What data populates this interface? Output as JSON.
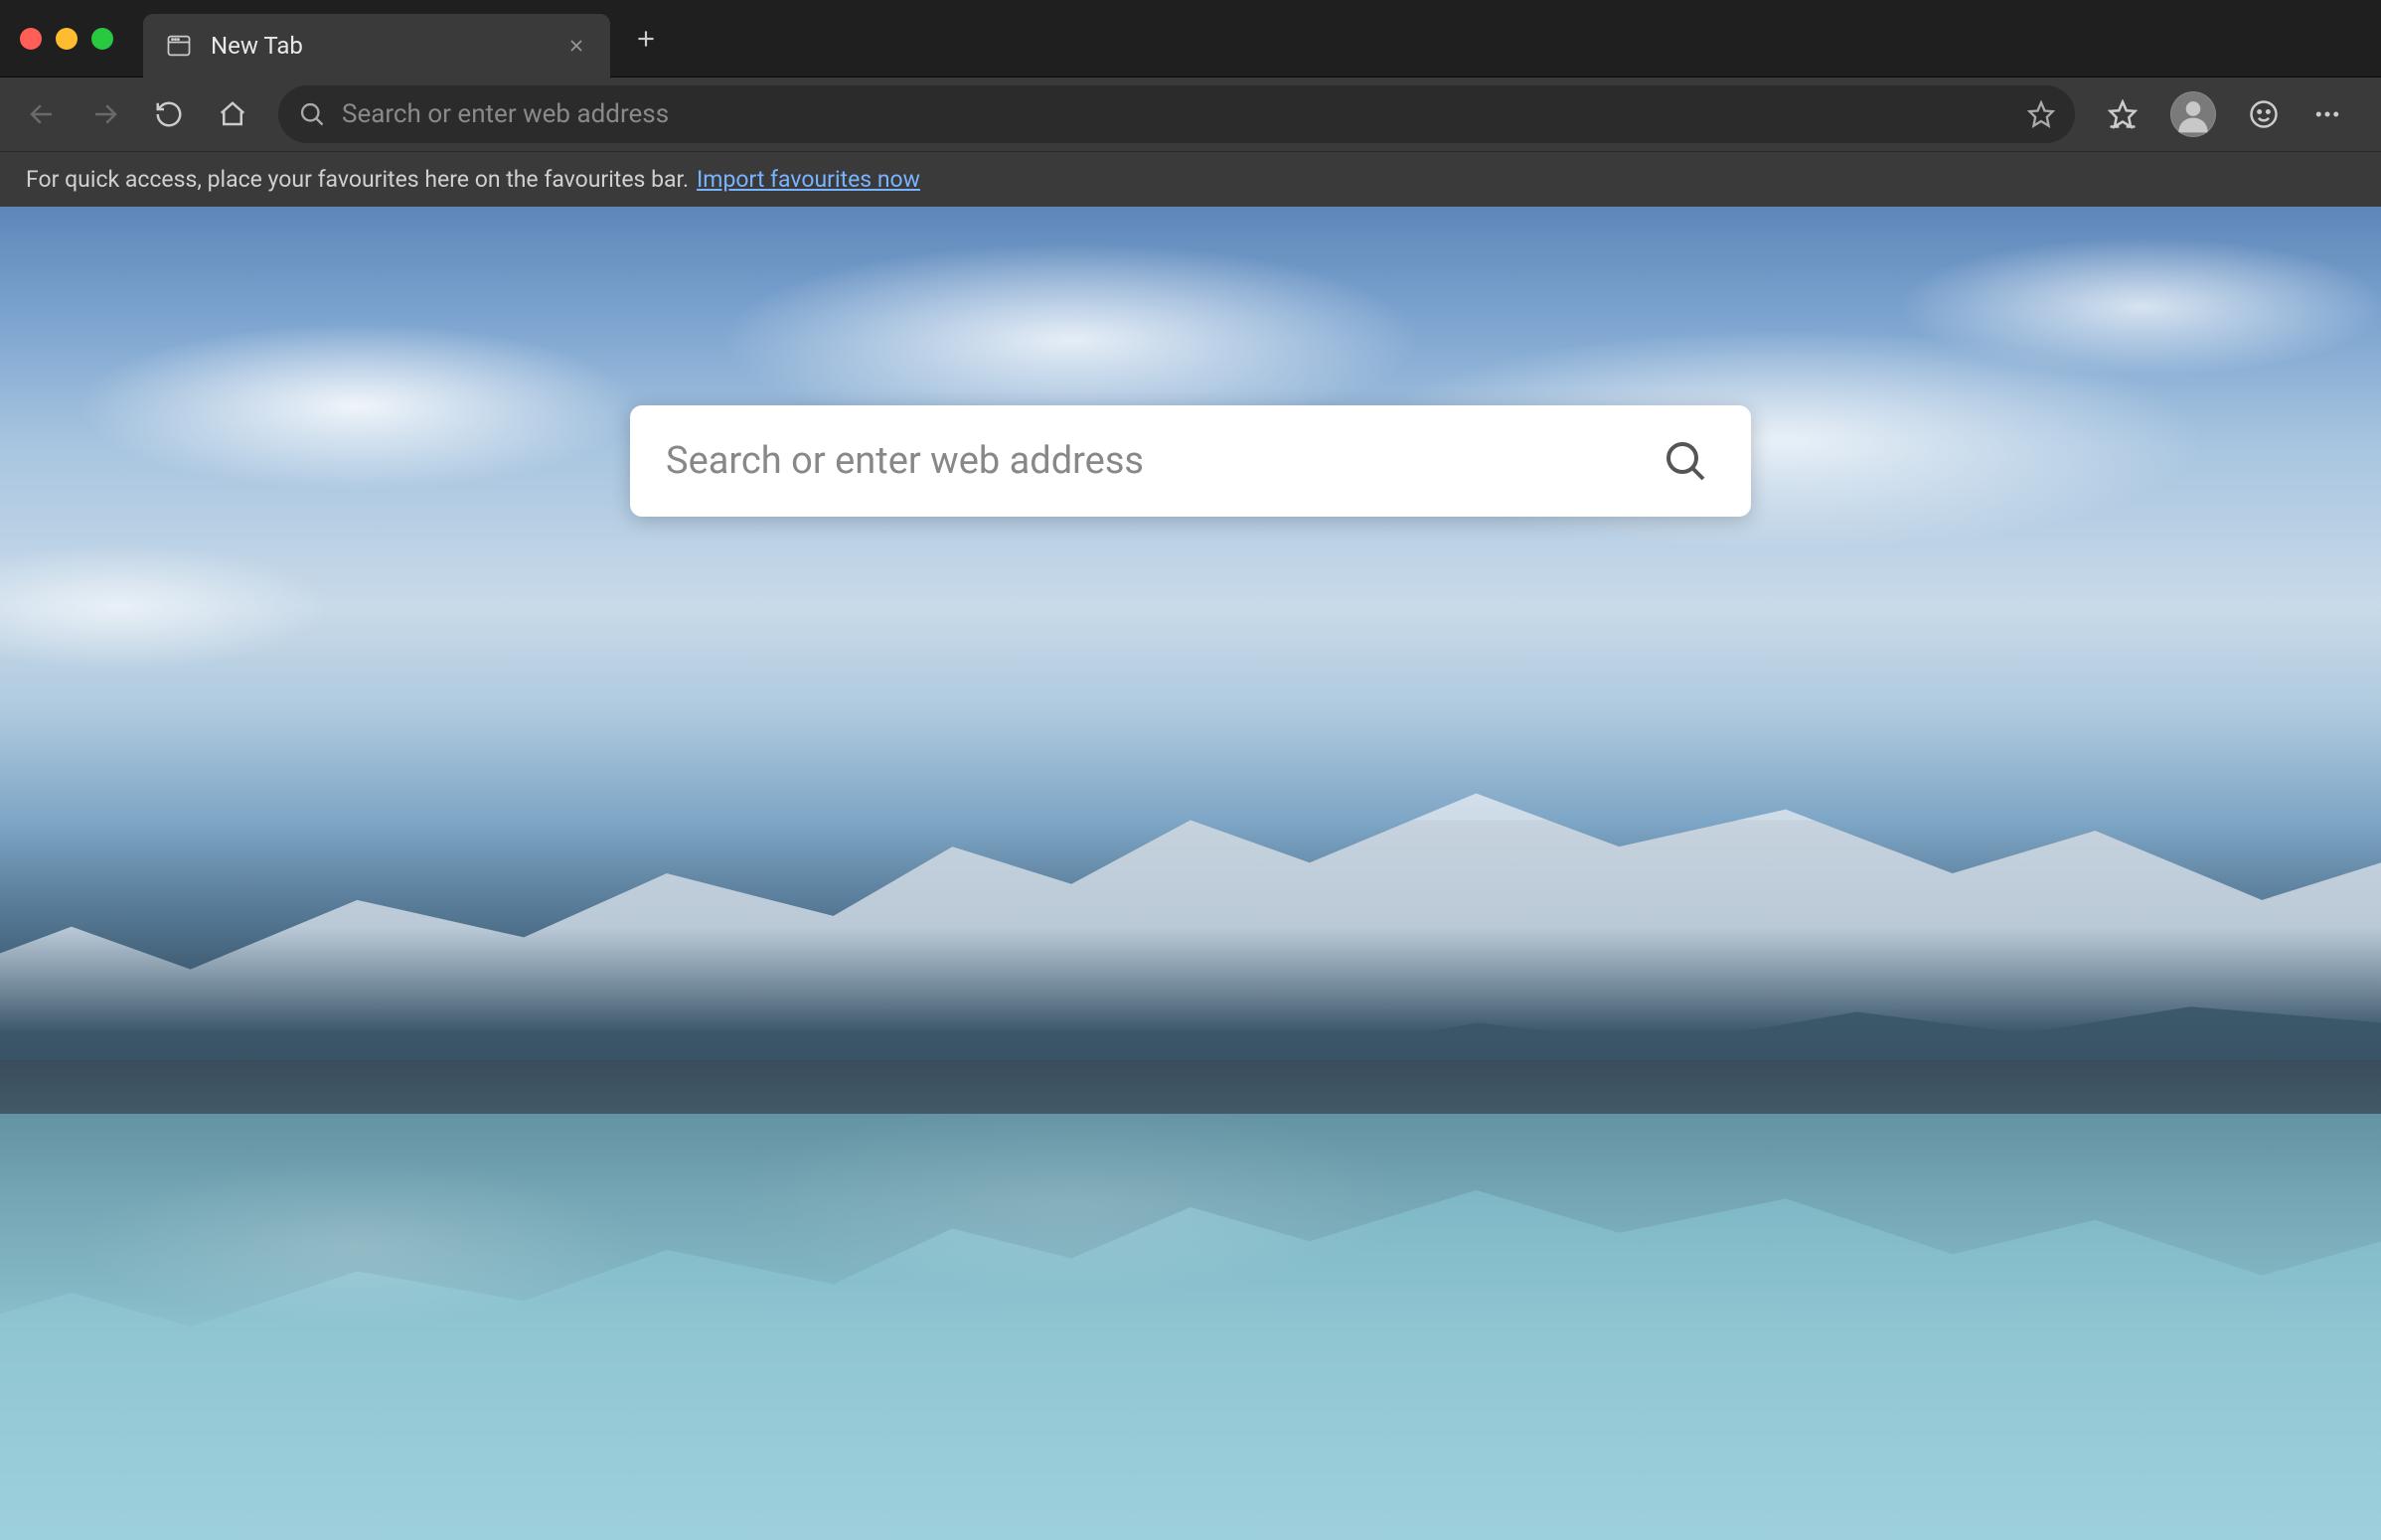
{
  "tab": {
    "title": "New Tab"
  },
  "toolbar": {
    "address_placeholder": "Search or enter web address"
  },
  "favorites_bar": {
    "hint_text": "For quick access, place your favourites here on the favourites bar.",
    "import_link": "Import favourites now"
  },
  "content": {
    "search_placeholder": "Search or enter web address"
  },
  "icons": {
    "favicon": "page-icon",
    "close": "close-icon",
    "plus": "plus-icon",
    "back": "back-arrow-icon",
    "forward": "forward-arrow-icon",
    "refresh": "refresh-icon",
    "home": "home-icon",
    "search": "search-icon",
    "star": "star-icon",
    "favorites": "favorites-star-icon",
    "profile": "avatar-icon",
    "feedback": "smiley-icon",
    "menu": "more-icon",
    "big_search": "search-icon"
  }
}
